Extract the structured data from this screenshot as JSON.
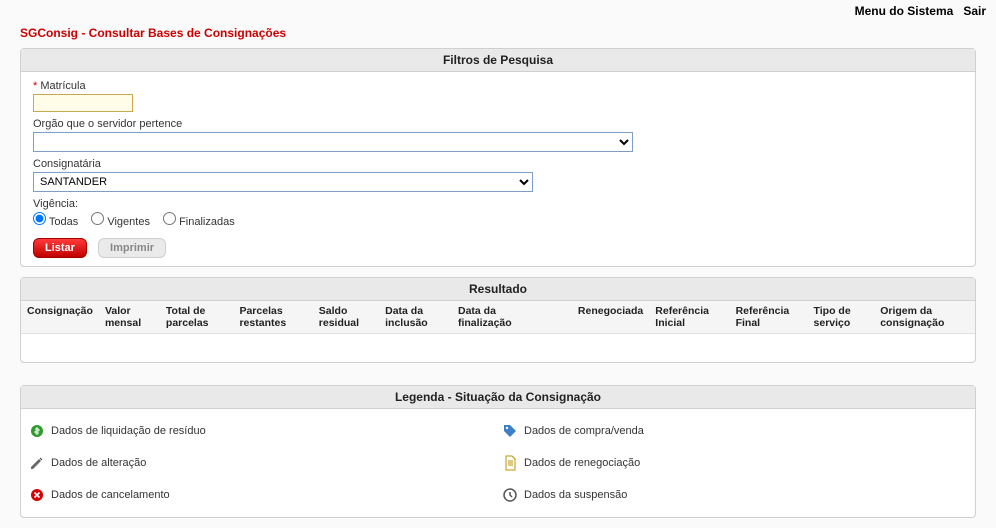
{
  "top_menu": {
    "menu_sistema": "Menu do Sistema",
    "sair": "Sair"
  },
  "page_title": "SGConsig - Consultar Bases de Consignações",
  "filters": {
    "header": "Filtros de Pesquisa",
    "matricula": {
      "label": "Matrícula",
      "value": ""
    },
    "orgao": {
      "label": "Orgão que o servidor pertence",
      "value": ""
    },
    "consignataria": {
      "label": "Consignatária",
      "value": "SANTANDER",
      "option": "SANTANDER"
    },
    "vigencia": {
      "label": "Vigência:",
      "todas": "Todas",
      "vigentes": "Vigentes",
      "finalizadas": "Finalizadas",
      "selected": "Todas"
    },
    "buttons": {
      "listar": "Listar",
      "imprimir": "Imprimir"
    }
  },
  "result": {
    "header": "Resultado",
    "columns": {
      "consignacao": "Consignação",
      "valor_mensal": "Valor mensal",
      "total_parcelas": "Total de parcelas",
      "parcelas_restantes": "Parcelas restantes",
      "saldo_residual": "Saldo residual",
      "data_inclusao": "Data da inclusão",
      "data_finalizacao": "Data da finalização",
      "renegociada": "Renegociada",
      "ref_inicial": "Referência Inicial",
      "ref_final": "Referência Final",
      "tipo_servico": "Tipo de serviço",
      "origem": "Origem da consignação"
    }
  },
  "legend": {
    "header": "Legenda - Situação da Consignação",
    "items": {
      "liquidacao": "Dados de liquidação de resíduo",
      "compra_venda": "Dados de compra/venda",
      "alteracao": "Dados de alteração",
      "renegociacao": "Dados de renegociação",
      "cancelamento": "Dados de cancelamento",
      "suspensao": "Dados da suspensão"
    }
  }
}
